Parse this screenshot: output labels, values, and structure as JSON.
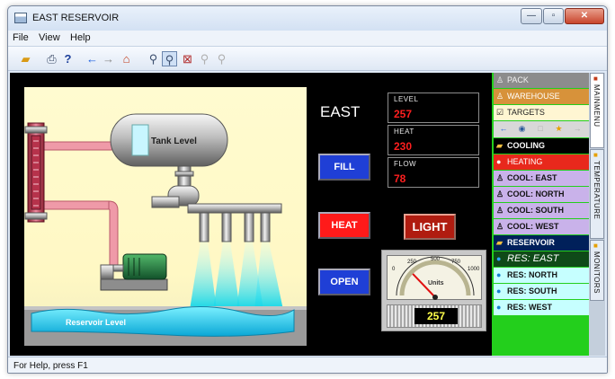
{
  "window": {
    "title": "EAST RESERVOIR"
  },
  "menu": {
    "items": [
      "File",
      "View",
      "Help"
    ]
  },
  "toolbar": {
    "buttons": [
      "open-icon",
      "print-icon",
      "help-pointer-icon",
      "back-icon",
      "forward-icon",
      "home-icon",
      "zoom-icon",
      "zoom-box-icon",
      "zoom-reset-icon",
      "zoom-in-icon",
      "zoom-out-icon"
    ]
  },
  "scene": {
    "tank_label": "Tank Level",
    "reservoir_label": "Reservoir Level"
  },
  "panel": {
    "title": "EAST",
    "buttons": {
      "fill": "FILL",
      "heat": "HEAT",
      "open": "OPEN",
      "light": "LIGHT"
    }
  },
  "readouts": [
    {
      "label": "LEVEL",
      "value": "257"
    },
    {
      "label": "HEAT",
      "value": "230"
    },
    {
      "label": "FLOW",
      "value": "78"
    }
  ],
  "gauge": {
    "ticks": [
      "0",
      "250",
      "500",
      "750",
      "1000"
    ],
    "unit": "Units",
    "value": "257",
    "reading": 257,
    "max": 1000
  },
  "side_menu": {
    "items": [
      {
        "label": "PACK",
        "icon": "user-icon",
        "style": "gray"
      },
      {
        "label": "WAREHOUSE",
        "icon": "user-icon",
        "style": "orange"
      },
      {
        "label": "TARGETS",
        "icon": "checklist-icon",
        "style": "cream"
      },
      {
        "label": "COOLING",
        "icon": "folder-icon",
        "style": "black"
      },
      {
        "label": "HEATING",
        "icon": "drop-icon",
        "style": "red"
      },
      {
        "label": "COOL: EAST",
        "icon": "user-icon",
        "style": "lilac"
      },
      {
        "label": "COOL: NORTH",
        "icon": "user-icon",
        "style": "lilac"
      },
      {
        "label": "COOL: SOUTH",
        "icon": "user-icon",
        "style": "lilac"
      },
      {
        "label": "COOL: WEST",
        "icon": "user-icon",
        "style": "lilac"
      },
      {
        "label": "RESERVOIR",
        "icon": "folder-icon",
        "style": "navy"
      },
      {
        "label": "RES: EAST",
        "icon": "drop-icon",
        "style": "darkgreen"
      },
      {
        "label": "RES: NORTH",
        "icon": "drop-icon",
        "style": "cyan"
      },
      {
        "label": "RES: SOUTH",
        "icon": "drop-icon",
        "style": "cyan"
      },
      {
        "label": "RES: WEST",
        "icon": "drop-icon",
        "style": "cyan"
      }
    ],
    "nav_icons": [
      "back-icon",
      "globe-icon",
      "blank-icon",
      "star-icon",
      "forward-icon"
    ]
  },
  "vertical_tabs": [
    "MAINMENU",
    "TEMPERATURE",
    "MONITORS"
  ],
  "status": {
    "text": "For Help, press F1"
  },
  "colors": {
    "fill": "#1f3fd6",
    "heat": "#ff1a1a",
    "open": "#1f3fd6",
    "light": "#b01c10",
    "panel_green": "#23cf1c",
    "readout_value": "#ff1f1f"
  }
}
